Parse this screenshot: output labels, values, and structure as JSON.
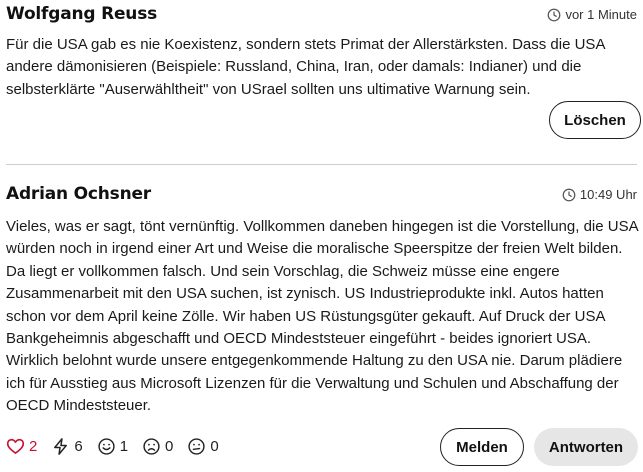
{
  "comments": [
    {
      "author": "Wolfgang Reuss",
      "time": "vor 1 Minute",
      "text": "Für die USA gab es nie Koexistenz, sondern stets Primat der Allerstärksten. Dass die USA andere dämonisieren (Beispiele: Russland, China, Iran, oder damals: Indianer) und die selbsterklärte \"Auserwähltheit\" von USrael sollten uns ultimative Warnung sein.",
      "delete_label": "Löschen"
    },
    {
      "author": "Adrian Ochsner",
      "time": "10:49 Uhr",
      "text": "Vieles, was er sagt, tönt vernünftig. Vollkommen daneben hingegen ist die Vorstellung, die USA würden noch in irgend einer Art und Weise die moralische Speerspitze der freien Welt bilden. Da liegt er vollkommen falsch. Und sein Vorschlag, die Schweiz müsse eine engere Zusammenarbeit mit den USA suchen, ist zynisch. US Industrieprodukte inkl. Autos hatten schon vor dem April keine Zölle. Wir haben US Rüstungsgüter gekauft. Auf Druck der USA Bankgeheimnis abgeschafft und OECD Mindeststeuer eingeführt - beides ignoriert USA. Wirklich belohnt wurde unsere entgegenkommende Haltung zu den USA nie. Darum plädiere ich für Ausstieg aus Microsoft Lizenzen für die Verwaltung und Schulen und Abschaffung der OECD Mindeststeuer.",
      "reactions": {
        "like": "2",
        "zap": "6",
        "smile": "1",
        "sad": "0",
        "meh": "0"
      },
      "report_label": "Melden",
      "answer_label": "Antworten"
    }
  ],
  "colors": {
    "like": "#c8102e",
    "divider": "#cfcfcf",
    "answer_bg": "#e6e6e6"
  },
  "icons": [
    "clock-icon",
    "heart-icon",
    "zap-icon",
    "smile-icon",
    "sad-icon",
    "meh-icon"
  ]
}
